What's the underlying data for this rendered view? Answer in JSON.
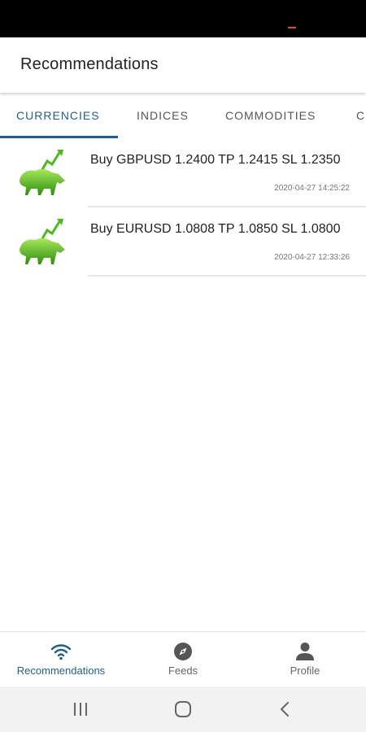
{
  "app": {
    "title": "Recommendations"
  },
  "tabs": [
    {
      "label": "CURRENCIES",
      "active": true
    },
    {
      "label": "INDICES",
      "active": false
    },
    {
      "label": "COMMODITIES",
      "active": false
    },
    {
      "label": "C",
      "active": false
    }
  ],
  "recommendations": [
    {
      "text": "Buy GBPUSD 1.2400 TP 1.2415 SL 1.2350",
      "timestamp": "2020-04-27 14:25:22",
      "icon": "bull-arrow-icon"
    },
    {
      "text": "Buy EURUSD 1.0808 TP 1.0850 SL 1.0800",
      "timestamp": "2020-04-27 12:33:26",
      "icon": "bull-arrow-icon"
    }
  ],
  "bottom_nav": [
    {
      "label": "Recommendations",
      "icon": "wifi-icon",
      "active": true
    },
    {
      "label": "Feeds",
      "icon": "compass-icon",
      "active": false
    },
    {
      "label": "Profile",
      "icon": "person-icon",
      "active": false
    }
  ],
  "colors": {
    "accent": "#1f5f8b",
    "bull_green": "#5cc41a"
  }
}
